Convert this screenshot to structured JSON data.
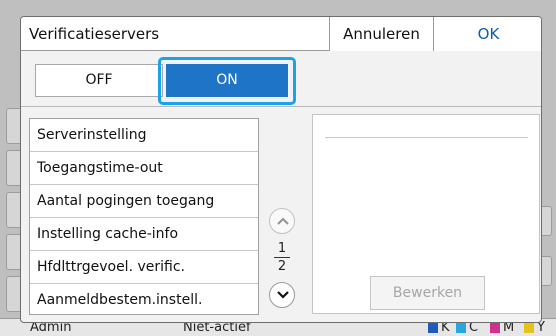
{
  "dialog": {
    "title": "Verificatieservers",
    "cancel_label": "Annuleren",
    "ok_label": "OK"
  },
  "toggle": {
    "off_label": "OFF",
    "on_label": "ON",
    "selected": "ON"
  },
  "settings_list": [
    "Serverinstelling",
    "Toegangstime-out",
    "Aantal pogingen toegang",
    "Instelling cache-info",
    "Hfdlttrgevoel. verific.",
    "Aanmeldbestem.instell."
  ],
  "pagination": {
    "current": "1",
    "total": "2"
  },
  "detail": {
    "edit_label": "Bewerken"
  },
  "background": {
    "status_user": "Admin",
    "status_state": "Niet-actief",
    "ink_labels": [
      "K",
      "C",
      "M",
      "Y"
    ]
  },
  "colors": {
    "accent": "#1e74c7",
    "focus_ring": "#1aa3e8",
    "ok_text": "#0b5fb0"
  }
}
